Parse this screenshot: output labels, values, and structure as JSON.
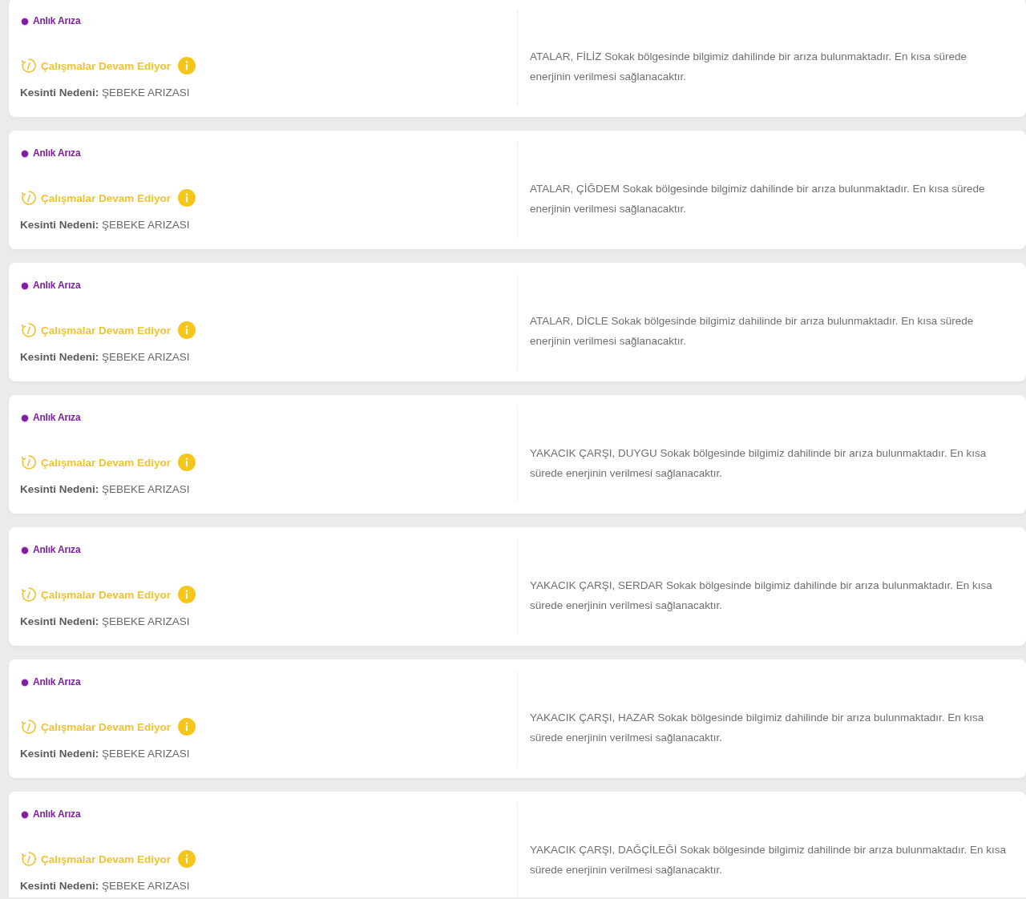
{
  "outages": [
    {
      "type": "Anlık Arıza",
      "status": "Çalışmalar Devam Ediyor",
      "cause_label": "Kesinti Nedeni:",
      "cause": "ŞEBEKE ARIZASI",
      "description": "ATALAR, FİLİZ Sokak bölgesinde bilgimiz dahilinde bir arıza bulunmaktadır. En kısa sürede enerjinin verilmesi sağlanacaktır."
    },
    {
      "type": "Anlık Arıza",
      "status": "Çalışmalar Devam Ediyor",
      "cause_label": "Kesinti Nedeni:",
      "cause": "ŞEBEKE ARIZASI",
      "description": "ATALAR, ÇİĞDEM Sokak bölgesinde bilgimiz dahilinde bir arıza bulunmaktadır. En kısa sürede enerjinin verilmesi sağlanacaktır."
    },
    {
      "type": "Anlık Arıza",
      "status": "Çalışmalar Devam Ediyor",
      "cause_label": "Kesinti Nedeni:",
      "cause": "ŞEBEKE ARIZASI",
      "description": "ATALAR, DİCLE Sokak bölgesinde bilgimiz dahilinde bir arıza bulunmaktadır. En kısa sürede enerjinin verilmesi sağlanacaktır."
    },
    {
      "type": "Anlık Arıza",
      "status": "Çalışmalar Devam Ediyor",
      "cause_label": "Kesinti Nedeni:",
      "cause": "ŞEBEKE ARIZASI",
      "description": "YAKACIK ÇARŞI, DUYGU Sokak bölgesinde bilgimiz dahilinde bir arıza bulunmaktadır. En kısa sürede enerjinin verilmesi sağlanacaktır."
    },
    {
      "type": "Anlık Arıza",
      "status": "Çalışmalar Devam Ediyor",
      "cause_label": "Kesinti Nedeni:",
      "cause": "ŞEBEKE ARIZASI",
      "description": "YAKACIK ÇARŞI, SERDAR Sokak bölgesinde bilgimiz dahilinde bir arıza bulunmaktadır. En kısa sürede enerjinin verilmesi sağlanacaktır."
    },
    {
      "type": "Anlık Arıza",
      "status": "Çalışmalar Devam Ediyor",
      "cause_label": "Kesinti Nedeni:",
      "cause": "ŞEBEKE ARIZASI",
      "description": "YAKACIK ÇARŞI, HAZAR Sokak bölgesinde bilgimiz dahilinde bir arıza bulunmaktadır. En kısa sürede enerjinin verilmesi sağlanacaktır."
    },
    {
      "type": "Anlık Arıza",
      "status": "Çalışmalar Devam Ediyor",
      "cause_label": "Kesinti Nedeni:",
      "cause": "ŞEBEKE ARIZASI",
      "description": "YAKACIK ÇARŞI, DAĞÇİLEĞİ Sokak bölgesinde bilgimiz dahilinde bir arıza bulunmaktadır. En kısa sürede enerjinin verilmesi sağlanacaktır."
    }
  ]
}
